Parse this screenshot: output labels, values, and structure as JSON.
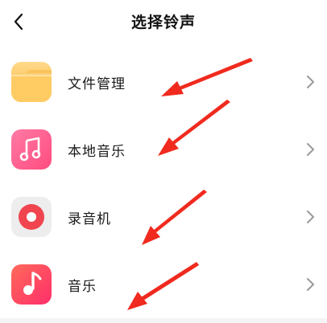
{
  "header": {
    "title": "选择铃声",
    "back_icon": "chevron-left-icon"
  },
  "items": [
    {
      "label": "文件管理",
      "icon": "folder-icon",
      "icon_color": "#FFC85A"
    },
    {
      "label": "本地音乐",
      "icon": "music-note-icon",
      "icon_color": "#FF5A8C"
    },
    {
      "label": "录音机",
      "icon": "record-icon",
      "icon_color": "#F0454F"
    },
    {
      "label": "音乐",
      "icon": "music-app-icon",
      "icon_color": "#FF3B5C"
    }
  ],
  "colors": {
    "annotation_arrow": "#F02A1E",
    "chevron": "#9A9A9A"
  }
}
